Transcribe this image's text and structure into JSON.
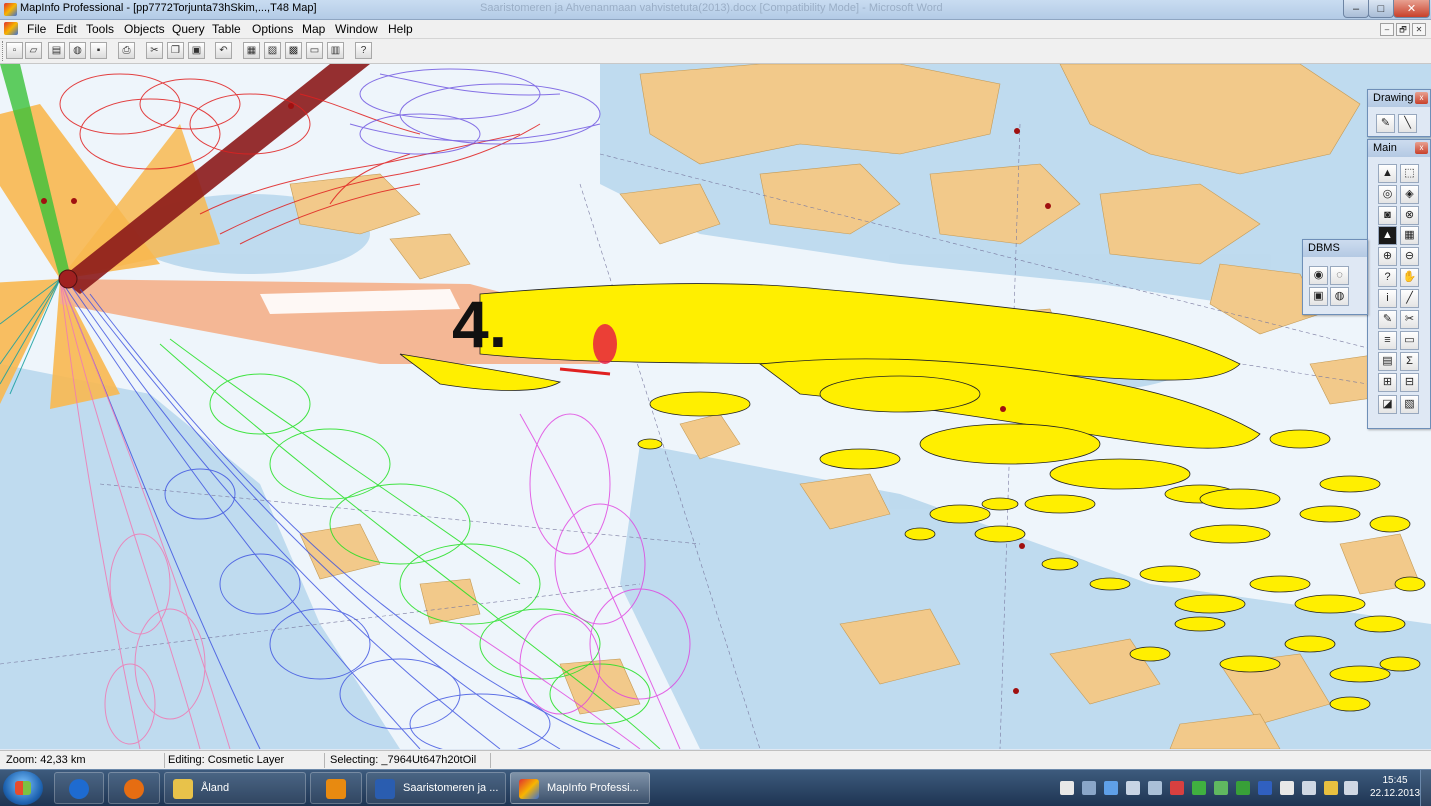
{
  "window": {
    "title": "MapInfo Professional - [pp7772Torjunta73hSkim,...,T48 Map]",
    "background_title": "Saaristomeren ja Ahvenanmaan vahvistetuta(2013).docx [Compatibility Mode] - Microsoft Word",
    "minimize_glyph": "‒",
    "maximize_glyph": "□",
    "close_glyph": "✕"
  },
  "menu": [
    "File",
    "Edit",
    "Tools",
    "Objects",
    "Query",
    "Table",
    "Options",
    "Map",
    "Window",
    "Help"
  ],
  "mdi_controls": [
    "‒",
    "🗗",
    "✕"
  ],
  "toolbar_icons": [
    "new-document-icon",
    "open-folder-icon",
    "open-workspace-icon",
    "open-dbms-icon",
    "save-icon",
    "print-icon",
    "cut-icon",
    "copy-icon",
    "paste-icon",
    "undo-icon",
    "new-browser-icon",
    "new-mapper-icon",
    "new-grapher-icon",
    "new-layout-icon",
    "new-redistrict-icon",
    "help-pointer-icon"
  ],
  "map": {
    "label": "4."
  },
  "palettes": {
    "drawing": {
      "title": "Drawing",
      "close": "x"
    },
    "main": {
      "title": "Main",
      "close": "x"
    },
    "dbms": {
      "title": "DBMS"
    }
  },
  "main_tools": [
    "▲",
    "⬚",
    "◎",
    "◈",
    "◙",
    "⊗",
    "▲",
    "▦",
    "⊕",
    "⊖",
    "?",
    "✋",
    "i",
    "╱",
    "✎",
    "✂",
    "≡",
    "▭",
    "▤",
    "Σ",
    "⊞",
    "⊟",
    "◪",
    "▧"
  ],
  "status": {
    "zoom": "Zoom: 42,33 km",
    "editing": "Editing: Cosmetic Layer",
    "selecting": "Selecting: _7964Ut647h20tOil"
  },
  "taskbar": {
    "items": [
      {
        "label": "",
        "color": "#1e6bd0"
      },
      {
        "label": "",
        "color": "#e66d12"
      },
      {
        "label": "Åland",
        "color": "#e8c24a"
      },
      {
        "label": "",
        "color": "#e88a10"
      },
      {
        "label": "Saaristomeren ja ...",
        "color": "#2a5db0"
      },
      {
        "label": "MapInfo Professi...",
        "color": "#d84a2a"
      }
    ],
    "time": "15:45",
    "date": "22.12.2013"
  },
  "colors": {
    "sea": "#eef5fb",
    "shallow": "#b6d6ec",
    "land": "#f2c98a",
    "oil_yellow": "#ffef00",
    "trajectory_red": "#e02020",
    "trajectory_blue": "#3a4fe0",
    "trajectory_green": "#22e022",
    "trajectory_magenta": "#e040e0",
    "trajectory_pink": "#f07ab4",
    "cone_orange": "#f8b850",
    "cone_brown": "#8b1a1a"
  }
}
